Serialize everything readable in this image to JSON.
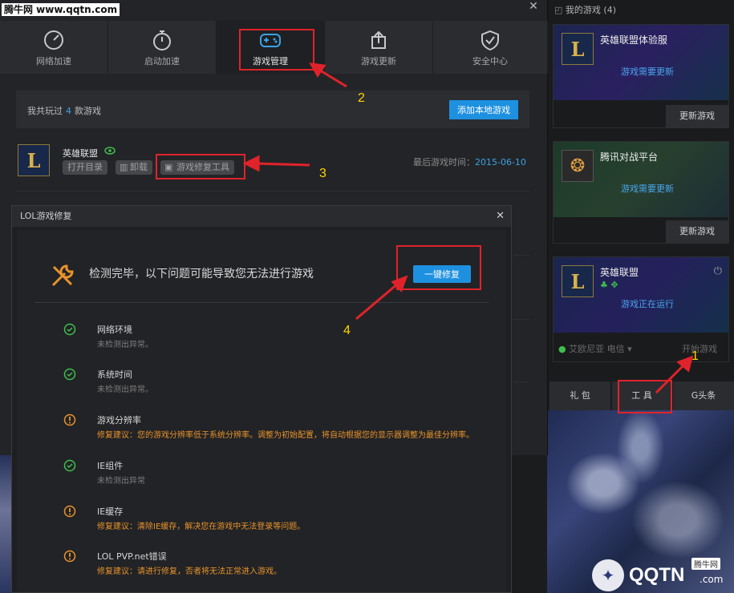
{
  "watermark": "腾牛网 www.qqtn.com",
  "nav": {
    "items": [
      {
        "label": "网络加速",
        "icon": "speedometer-icon"
      },
      {
        "label": "启动加速",
        "icon": "stopwatch-icon"
      },
      {
        "label": "游戏管理",
        "icon": "gamepad-icon"
      },
      {
        "label": "游戏更新",
        "icon": "update-arrow-icon"
      },
      {
        "label": "安全中心",
        "icon": "shield-check-icon"
      }
    ],
    "active_index": 2
  },
  "summary": {
    "prefix": "我共玩过",
    "count": "4",
    "suffix": "款游戏",
    "add_button": "添加本地游戏"
  },
  "game": {
    "name": "英雄联盟",
    "buttons": [
      "打开目录",
      "卸载",
      "游戏修复工具"
    ],
    "last_played_label": "最后游戏时间：",
    "last_played_date": "2015-06-10"
  },
  "dialog": {
    "title": "LOL游戏修复",
    "headline": "检测完毕，以下问题可能导致您无法进行游戏",
    "fix_button": "一键修复",
    "items": [
      {
        "status": "ok",
        "title": "网络环境",
        "desc": "未检测出异常。"
      },
      {
        "status": "ok",
        "title": "系统时间",
        "desc": "未检测出异常。"
      },
      {
        "status": "warn",
        "title": "游戏分辨率",
        "desc": "修复建议：您的游戏分辨率低于系统分辨率。调整为初始配置，将自动根据您的显示器调整为最佳分辨率。"
      },
      {
        "status": "ok",
        "title": "IE组件",
        "desc": "未检测出异常"
      },
      {
        "status": "warn",
        "title": "IE缓存",
        "desc": "修复建议：清除IE缓存，解决您在游戏中无法登录等问题。"
      },
      {
        "status": "warn",
        "title": "LOL PVP.net错误",
        "desc": "修复建议：请进行修复，否者将无法正常进入游戏。"
      }
    ]
  },
  "sidebar": {
    "title": "我的游戏 (4)",
    "cards": [
      {
        "name": "英雄联盟体验服",
        "status": "游戏需要更新",
        "button": "更新游戏"
      },
      {
        "name": "腾讯对战平台",
        "status": "游戏需要更新",
        "button": "更新游戏"
      },
      {
        "name": "英雄联盟",
        "status": "游戏正在运行",
        "server": "艾欧尼亚 电信",
        "button": "开始游戏"
      }
    ],
    "tools": [
      "礼 包",
      "工 具",
      "G头条"
    ]
  },
  "annotations": [
    "1",
    "2",
    "3",
    "4"
  ],
  "brand": {
    "logo_text": "QQTN",
    "sub": ".com",
    "badge": "腾牛网"
  },
  "colors": {
    "accent_blue": "#1e90e0",
    "ok_green": "#3fbf4f",
    "warn_orange": "#e8932b",
    "annotation_red": "#e0232a",
    "annotation_yellow": "#ffd400"
  }
}
